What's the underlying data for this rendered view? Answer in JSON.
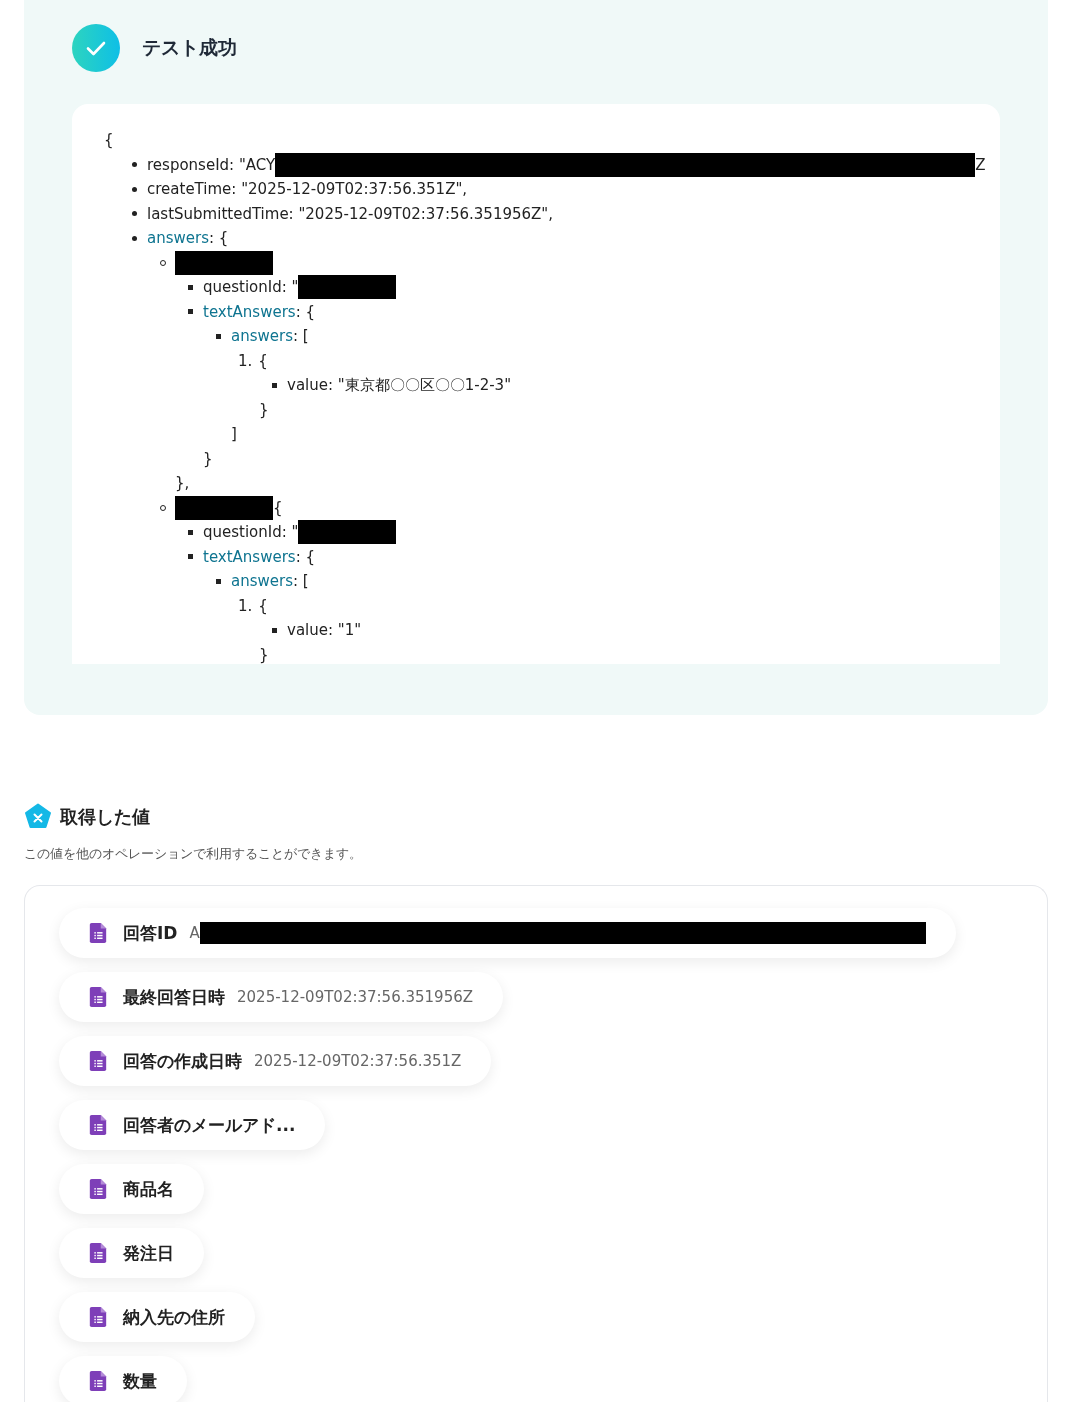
{
  "result_panel": {
    "title": "テスト成功",
    "code": {
      "open": "{",
      "items": [
        {
          "kind": "disc",
          "key": "responseId",
          "key_is_object": false,
          "text": ": \"ACY",
          "redacted": true,
          "tail": "Z"
        },
        {
          "kind": "disc",
          "key": "createTime",
          "key_is_object": false,
          "text": ": \"2025-12-09T02:37:56.351Z\","
        },
        {
          "kind": "disc",
          "key": "lastSubmittedTime",
          "key_is_object": false,
          "text": ": \"2025-12-09T02:37:56.351956Z\","
        },
        {
          "kind": "disc",
          "key": "answers",
          "key_is_object": true,
          "text": ": {",
          "children": [
            {
              "kind": "circle",
              "redacted": true,
              "children": [
                {
                  "kind": "square",
                  "key": "questionId",
                  "key_is_object": false,
                  "text": ": \"",
                  "redacted": true
                },
                {
                  "kind": "square",
                  "key": "textAnswers",
                  "key_is_object": true,
                  "text": ": {",
                  "children": [
                    {
                      "kind": "square",
                      "key": "answers",
                      "key_is_object": true,
                      "text": ": [",
                      "children": [
                        {
                          "kind": "number",
                          "marker": "1.",
                          "text": "{",
                          "children": [
                            {
                              "kind": "square",
                              "key": "value",
                              "key_is_object": false,
                              "text": ": \"東京都〇〇区〇〇1-2-3\""
                            }
                          ],
                          "close": "}"
                        }
                      ],
                      "close": "]"
                    }
                  ],
                  "close": "}"
                }
              ],
              "close": "},"
            },
            {
              "kind": "circle",
              "redacted": true,
              "tail": " {",
              "children": [
                {
                  "kind": "square",
                  "key": "questionId",
                  "key_is_object": false,
                  "text": ": \"",
                  "redacted": true
                },
                {
                  "kind": "square",
                  "key": "textAnswers",
                  "key_is_object": true,
                  "text": ": {",
                  "children": [
                    {
                      "kind": "square",
                      "key": "answers",
                      "key_is_object": true,
                      "text": ": [",
                      "children": [
                        {
                          "kind": "number",
                          "marker": "1.",
                          "text": "{",
                          "children": [
                            {
                              "kind": "square",
                              "key": "value",
                              "key_is_object": false,
                              "text": ": \"1\""
                            }
                          ],
                          "close": "}"
                        }
                      ]
                    }
                  ]
                }
              ]
            }
          ]
        }
      ]
    }
  },
  "values_section": {
    "title": "取得した値",
    "subtitle": "この値を他のオペレーションで利用することができます。",
    "items": [
      {
        "label": "回答ID",
        "value": "A",
        "redacted": true
      },
      {
        "label": "最終回答日時",
        "value": "2025-12-09T02:37:56.351956Z"
      },
      {
        "label": "回答の作成日時",
        "value": "2025-12-09T02:37:56.351Z"
      },
      {
        "label": "回答者のメールアド..."
      },
      {
        "label": "商品名"
      },
      {
        "label": "発注日"
      },
      {
        "label": "納入先の住所"
      },
      {
        "label": "数量"
      }
    ]
  }
}
